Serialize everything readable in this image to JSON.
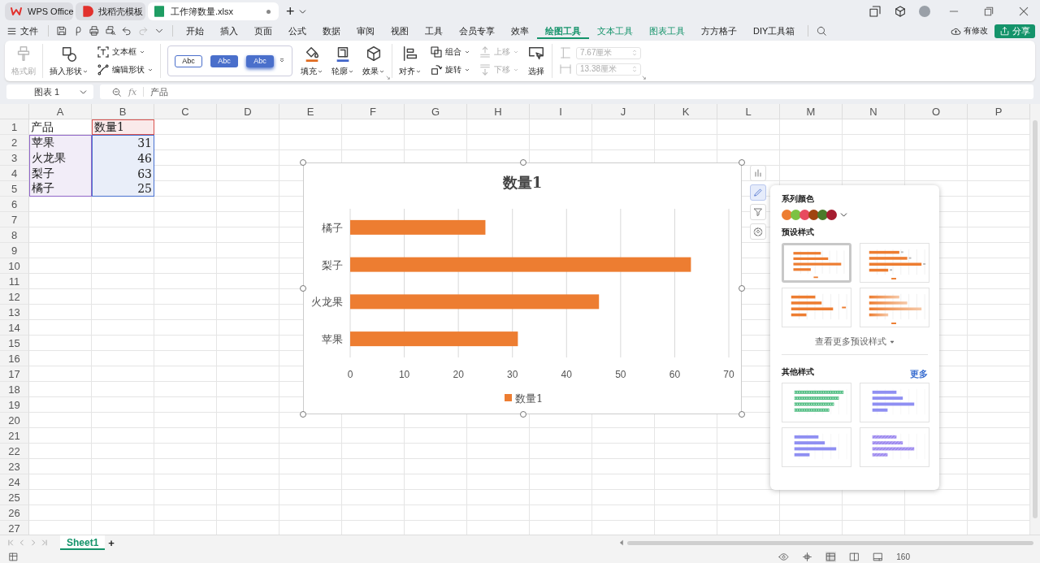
{
  "tabs": [
    {
      "label": "WPS Office",
      "kind": "wps",
      "selected": false
    },
    {
      "label": "找稻壳模板",
      "kind": "docer",
      "selected": false
    },
    {
      "label": "工作簿数量.xlsx",
      "kind": "sheet",
      "selected": true
    }
  ],
  "new_tab": "+",
  "file_menu": "文件",
  "menus": [
    {
      "label": "开始",
      "contextual": false,
      "selected": false
    },
    {
      "label": "插入",
      "contextual": false,
      "selected": false
    },
    {
      "label": "页面",
      "contextual": false,
      "selected": false
    },
    {
      "label": "公式",
      "contextual": false,
      "selected": false
    },
    {
      "label": "数据",
      "contextual": false,
      "selected": false
    },
    {
      "label": "审阅",
      "contextual": false,
      "selected": false
    },
    {
      "label": "视图",
      "contextual": false,
      "selected": false
    },
    {
      "label": "工具",
      "contextual": false,
      "selected": false
    },
    {
      "label": "会员专享",
      "contextual": false,
      "selected": false
    },
    {
      "label": "效率",
      "contextual": false,
      "selected": false
    },
    {
      "label": "绘图工具",
      "contextual": true,
      "selected": true
    },
    {
      "label": "文本工具",
      "contextual": true,
      "selected": false
    },
    {
      "label": "图表工具",
      "contextual": true,
      "selected": false
    },
    {
      "label": "方方格子",
      "contextual": false,
      "selected": false
    },
    {
      "label": "DIY工具箱",
      "contextual": false,
      "selected": false
    }
  ],
  "save_status": "有修改",
  "share": "分享",
  "ribbon": [
    {
      "items": [
        {
          "kind": "large",
          "label": "格式刷",
          "disabled": true
        }
      ]
    },
    {
      "items": [
        {
          "kind": "large",
          "label": "插入形状",
          "dropdown": true,
          "disabled": false
        },
        {
          "kind": "stack",
          "items": [
            {
              "label": "文本框",
              "dropdown": true,
              "disabled": false
            },
            {
              "label": "编辑形状",
              "dropdown": true,
              "disabled": false
            }
          ]
        }
      ]
    },
    {
      "launcher": true,
      "items": [
        {
          "kind": "gallery",
          "styles": [
            "Abc",
            "Abc",
            "Abc"
          ]
        },
        {
          "kind": "large",
          "label": "填充",
          "dropdown": true,
          "disabled": false
        },
        {
          "kind": "large",
          "label": "轮廓",
          "dropdown": true,
          "disabled": false
        },
        {
          "kind": "large",
          "label": "效果",
          "dropdown": true,
          "disabled": false
        }
      ]
    },
    {
      "items": [
        {
          "kind": "large",
          "label": "对齐",
          "dropdown": true,
          "disabled": false
        },
        {
          "kind": "stack",
          "items": [
            {
              "label": "组合",
              "dropdown": true,
              "disabled": false
            },
            {
              "label": "旋转",
              "dropdown": true,
              "disabled": false
            }
          ]
        },
        {
          "kind": "stack",
          "items": [
            {
              "label": "上移",
              "dropdown": true,
              "disabled": true
            },
            {
              "label": "下移",
              "dropdown": true,
              "disabled": true
            }
          ]
        },
        {
          "kind": "large",
          "label": "选择",
          "disabled": false
        }
      ]
    },
    {
      "launcher": true,
      "items": [
        {
          "kind": "sizes",
          "fields": [
            {
              "value": "7.67厘米",
              "disabled": true
            },
            {
              "value": "13.38厘米",
              "disabled": true
            }
          ]
        }
      ]
    }
  ],
  "name_box": "图表 1",
  "fx": "fx",
  "formula": "产品",
  "sheet": {
    "columns": [
      "A",
      "B",
      "C",
      "D",
      "E",
      "F",
      "G",
      "H",
      "I",
      "J",
      "K",
      "L",
      "M",
      "N",
      "O",
      "P"
    ],
    "rows": [
      {
        "number": "1",
        "cells": [
          {
            "text": "产品",
            "kind": "text"
          },
          {
            "text": "数量1",
            "kind": "text",
            "color": "#d9534f"
          }
        ]
      },
      {
        "number": "2",
        "cells": [
          {
            "text": "苹果",
            "kind": "text",
            "color": "#9066c8"
          },
          {
            "text": "31",
            "kind": "number",
            "color": "#4a72d0"
          }
        ]
      },
      {
        "number": "3",
        "cells": [
          {
            "text": "火龙果",
            "kind": "text",
            "color": "#9066c8"
          },
          {
            "text": "46",
            "kind": "number",
            "color": "#4a72d0"
          }
        ]
      },
      {
        "number": "4",
        "cells": [
          {
            "text": "梨子",
            "kind": "text",
            "color": "#9066c8"
          },
          {
            "text": "63",
            "kind": "number",
            "color": "#4a72d0"
          }
        ]
      },
      {
        "number": "5",
        "cells": [
          {
            "text": "橘子",
            "kind": "text",
            "color": "#9066c8"
          },
          {
            "text": "25",
            "kind": "number",
            "color": "#4a72d0"
          }
        ]
      },
      {
        "number": "6"
      },
      {
        "number": "7"
      },
      {
        "number": "8"
      },
      {
        "number": "9"
      },
      {
        "number": "10"
      },
      {
        "number": "11"
      },
      {
        "number": "12"
      },
      {
        "number": "13"
      },
      {
        "number": "14"
      },
      {
        "number": "15"
      },
      {
        "number": "16"
      },
      {
        "number": "17"
      },
      {
        "number": "18"
      },
      {
        "number": "19"
      },
      {
        "number": "20"
      },
      {
        "number": "21"
      },
      {
        "number": "22"
      },
      {
        "number": "23"
      },
      {
        "number": "24"
      },
      {
        "number": "25"
      },
      {
        "number": "26"
      },
      {
        "number": "27"
      }
    ]
  },
  "chart": {
    "chart_data": {
      "type": "bar",
      "orientation": "horizontal",
      "title": "数量1",
      "categories": [
        "橘子",
        "梨子",
        "火龙果",
        "苹果"
      ],
      "series": [
        {
          "name": "数量1",
          "color": "#ed7d31",
          "values": [
            25,
            63,
            46,
            31
          ]
        }
      ],
      "xlim": [
        0,
        70
      ],
      "xticks": [
        0,
        10,
        20,
        30,
        40,
        50,
        60,
        70
      ],
      "grid": true
    }
  },
  "chart_tools": [
    {
      "selected": false
    },
    {
      "selected": true
    },
    {
      "selected": false
    },
    {
      "selected": false
    }
  ],
  "style_panel": {
    "colors_title": "系列颜色",
    "colors": [
      {
        "color": "#ed7d31"
      },
      {
        "color": "#7cc242"
      },
      {
        "color": "#e84a5f"
      },
      {
        "color": "#a0440f"
      },
      {
        "color": "#4a7a2a"
      },
      {
        "color": "#a51c30"
      }
    ],
    "presets_title": "预设样式",
    "presets": [
      {
        "selected": true,
        "kind": "plain"
      },
      {
        "selected": false,
        "kind": "labels"
      },
      {
        "selected": false,
        "kind": "legend-right"
      },
      {
        "selected": false,
        "kind": "gradient"
      }
    ],
    "more_presets": "查看更多预设样式",
    "other_title": "其他样式",
    "other_more": "更多",
    "others": [
      {
        "kind": "dotted",
        "color": "#4cbb7f"
      },
      {
        "kind": "solid",
        "color": "#8f8ff2"
      },
      {
        "kind": "solid",
        "color": "#8f8ff2"
      },
      {
        "kind": "hatched",
        "color": "#9a86ee"
      }
    ]
  },
  "sheet_tabs": [
    {
      "label": "Sheet1",
      "selected": true
    }
  ],
  "add_sheet": "+",
  "zoom": "160"
}
